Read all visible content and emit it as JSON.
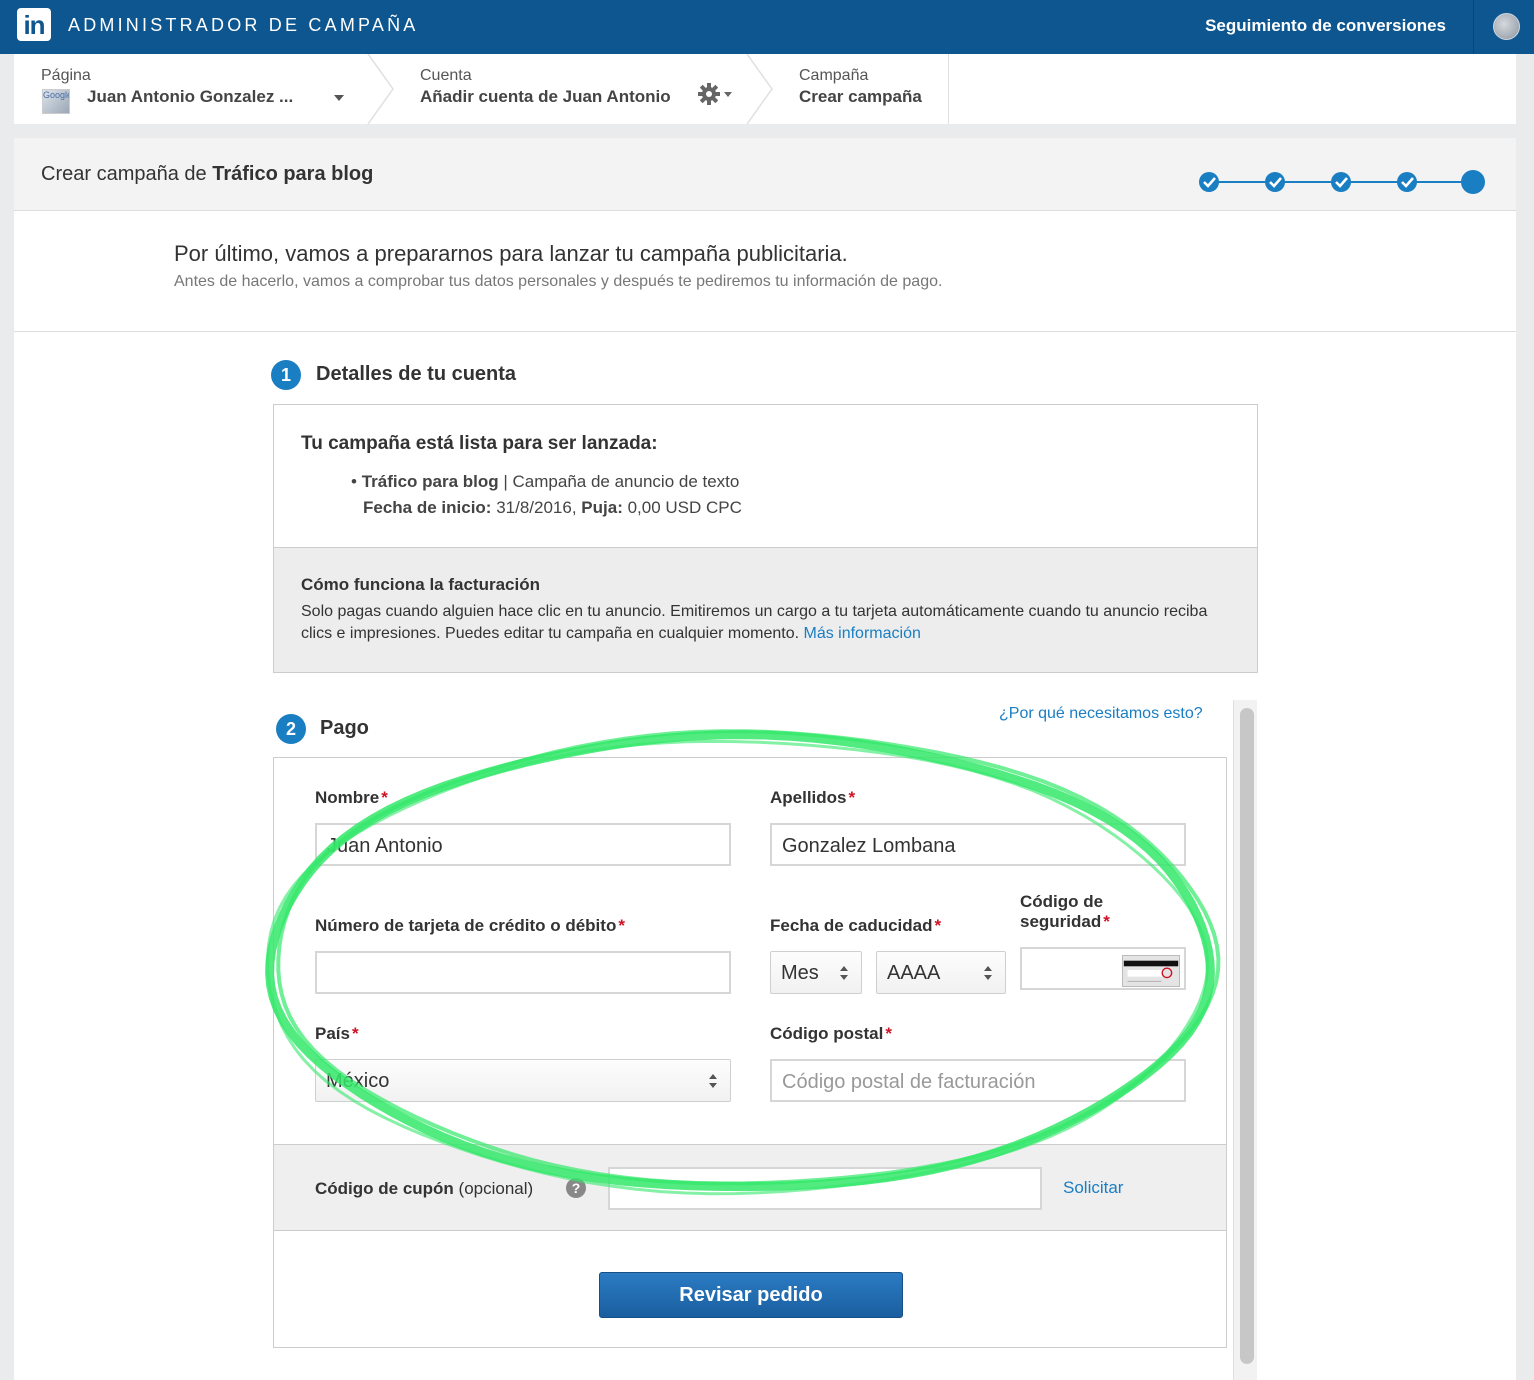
{
  "topbar": {
    "logo_text": "in",
    "app_title": "ADMINISTRADOR DE CAMPAÑA",
    "conversions_link": "Seguimiento de conversiones"
  },
  "breadcrumb": {
    "page_label": "Página",
    "page_value": "Juan Antonio Gonzalez ...",
    "page_thumb_text": "Google",
    "account_label": "Cuenta",
    "account_value": "Añadir cuenta de Juan Antonio",
    "campaign_label": "Campaña",
    "campaign_value": "Crear campaña"
  },
  "title": {
    "prefix": "Crear campaña de ",
    "name": "Tráfico para blog"
  },
  "progress": {
    "total_steps": 5,
    "completed_steps": 4,
    "accent": "#1a7ec2"
  },
  "intro": {
    "heading": "Por último, vamos a prepararnos para lanzar tu campaña publicitaria.",
    "subtext": "Antes de hacerlo, vamos a comprobar tus datos personales y después te pediremos tu información de pago."
  },
  "section1": {
    "number": "1",
    "title": "Detalles de tu cuenta",
    "ready_heading": "Tu campaña está lista para ser lanzada:",
    "bullet": "•",
    "campaign_name": "Tráfico para blog",
    "campaign_type": " | Campaña de anuncio de texto",
    "start_label": "Fecha de inicio:",
    "start_value": " 31/8/2016, ",
    "bid_label": "Puja:",
    "bid_value": " 0,00 USD CPC",
    "billing_title": "Cómo funciona la facturación",
    "billing_text": "Solo pagas cuando alguien hace clic en tu anuncio. Emitiremos un cargo a tu tarjeta automáticamente cuando tu anuncio reciba clics e impresiones. Puedes editar tu campaña en cualquier momento. ",
    "billing_link": "Más información"
  },
  "section2": {
    "number": "2",
    "title": "Pago",
    "why_link": "¿Por qué necesitamos esto?",
    "first_name_label": "Nombre",
    "first_name_value": "Juan Antonio",
    "last_name_label": "Apellidos",
    "last_name_value": "Gonzalez Lombana",
    "card_label": "Número de tarjeta de crédito o débito",
    "card_value": "",
    "expiry_label": "Fecha de caducidad",
    "month_value": "Mes",
    "year_value": "AAAA",
    "security_label_1": "Código de",
    "security_label_2": "seguridad",
    "country_label": "País",
    "country_value": "México",
    "zip_label": "Código postal",
    "zip_placeholder": "Código postal de facturación",
    "required_mark": "*",
    "coupon_label": "Código de cupón",
    "coupon_optional": " (opcional)",
    "coupon_help": "?",
    "coupon_value": "",
    "coupon_apply": "Solicitar",
    "review_button": "Revisar pedido"
  },
  "annotation": {
    "color": "#33e86a"
  }
}
